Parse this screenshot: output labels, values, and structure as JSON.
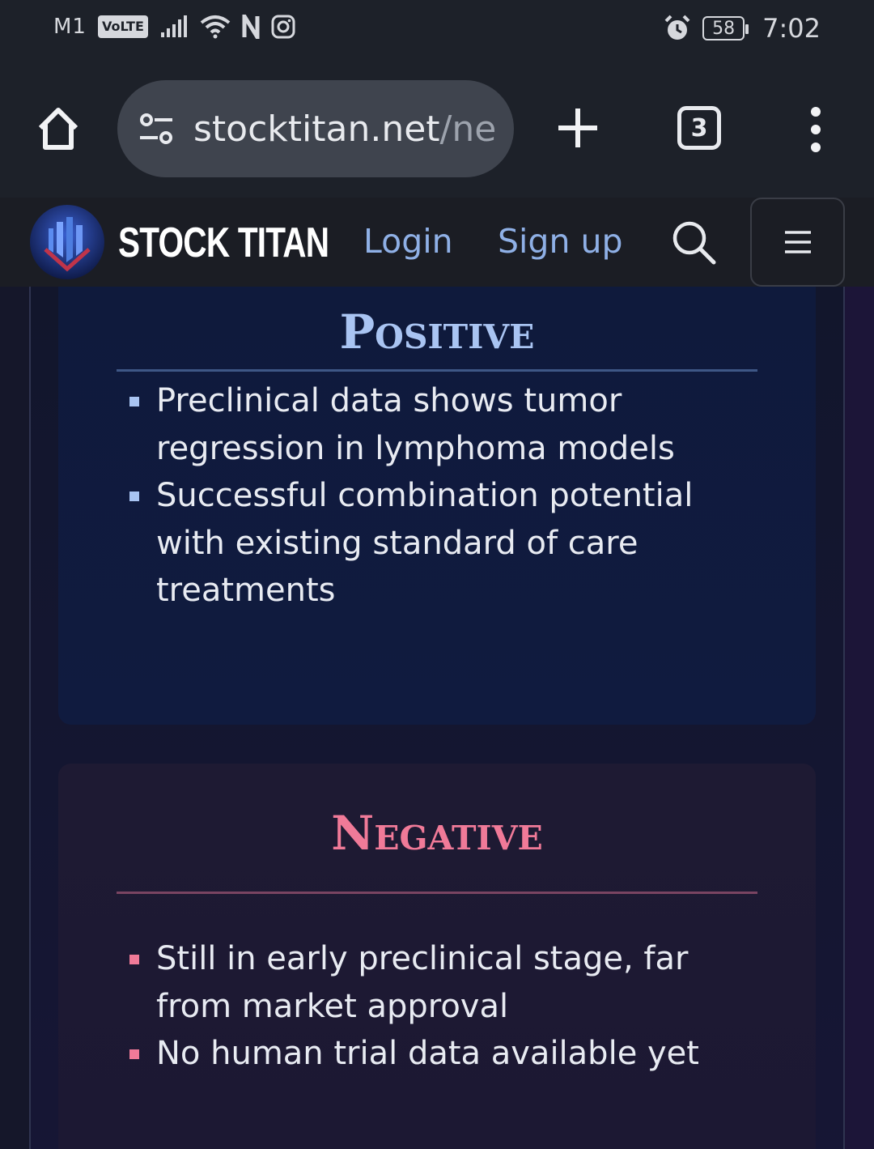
{
  "status_bar": {
    "carrier": "M1",
    "volte": "VoLTE",
    "network_icons": [
      "signal-icon",
      "wifi-icon",
      "nfc-icon",
      "instagram-icon"
    ],
    "alarm_icon": "alarm-icon",
    "battery": "58",
    "time": "7:02"
  },
  "browser": {
    "url_main": "stocktitan.net",
    "url_rest": "/ne",
    "tab_count": "3",
    "icons": [
      "home-icon",
      "site-settings-icon",
      "plus-icon",
      "tabs-icon",
      "more-vertical-icon"
    ]
  },
  "header": {
    "brand": "STOCK TITAN",
    "login": "Login",
    "signup": "Sign up",
    "icons": [
      "stock-titan-logo",
      "search-icon",
      "hamburger-menu-icon"
    ]
  },
  "positive": {
    "title": "Positive",
    "accent_color": "#a9c4f2",
    "items": [
      "Preclinical data shows tumor regression in lymphoma models",
      "Successful combination potential with existing standard of care treatments"
    ]
  },
  "negative": {
    "title": "Negative",
    "accent_color": "#f07a98",
    "items": [
      "Still in early preclinical stage, far from market approval",
      "No human trial data available yet"
    ]
  }
}
